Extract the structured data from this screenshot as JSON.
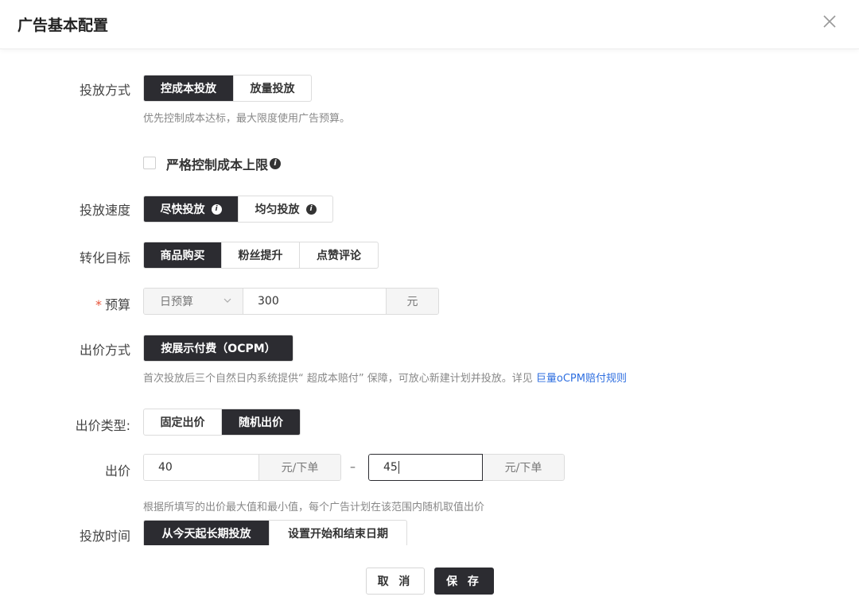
{
  "header": {
    "title": "广告基本配置",
    "close_icon": "close-icon"
  },
  "delivery_mode": {
    "label": "投放方式",
    "options": [
      "控成本投放",
      "放量投放"
    ],
    "selected": "控成本投放",
    "hint": "优先控制成本达标，最大限度使用广告预算。"
  },
  "strict_cost": {
    "label": "严格控制成本上限",
    "checked": false,
    "info_icon": "info-icon"
  },
  "delivery_speed": {
    "label": "投放速度",
    "options": [
      "尽快投放",
      "均匀投放"
    ],
    "selected": "尽快投放"
  },
  "conversion_goal": {
    "label": "转化目标",
    "options": [
      "商品购买",
      "粉丝提升",
      "点赞评论"
    ],
    "selected": "商品购买"
  },
  "budget": {
    "required_mark": "*",
    "label": "预算",
    "type_value": "日预算",
    "amount": "300",
    "unit": "元"
  },
  "bid_method": {
    "label": "出价方式",
    "options": [
      "按展示付费（OCPM）"
    ],
    "selected": "按展示付费（OCPM）",
    "hint": "首次投放后三个自然日内系统提供“ 超成本赔付” 保障，可放心新建计划并投放。详见 ",
    "hint_link": "巨量oCPM赔付规则"
  },
  "bid_type": {
    "label": "出价类型:",
    "options": [
      "固定出价",
      "随机出价"
    ],
    "selected": "随机出价"
  },
  "bid": {
    "label": "出价",
    "min_value": "40",
    "max_value": "45",
    "unit": "元/下单",
    "separator": "–",
    "hint": "根据所填写的出价最大值和最小值，每个广告计划在该范围内随机取值出价"
  },
  "schedule": {
    "label": "投放时间",
    "options": [
      "从今天起长期投放",
      "设置开始和结束日期"
    ],
    "selected": "从今天起长期投放"
  },
  "footer": {
    "cancel_label": "取 消",
    "save_label": "保 存"
  },
  "colors": {
    "active": "#2c2c31",
    "link": "#2f6fe0",
    "required": "#e8543a",
    "hint": "#888888"
  }
}
